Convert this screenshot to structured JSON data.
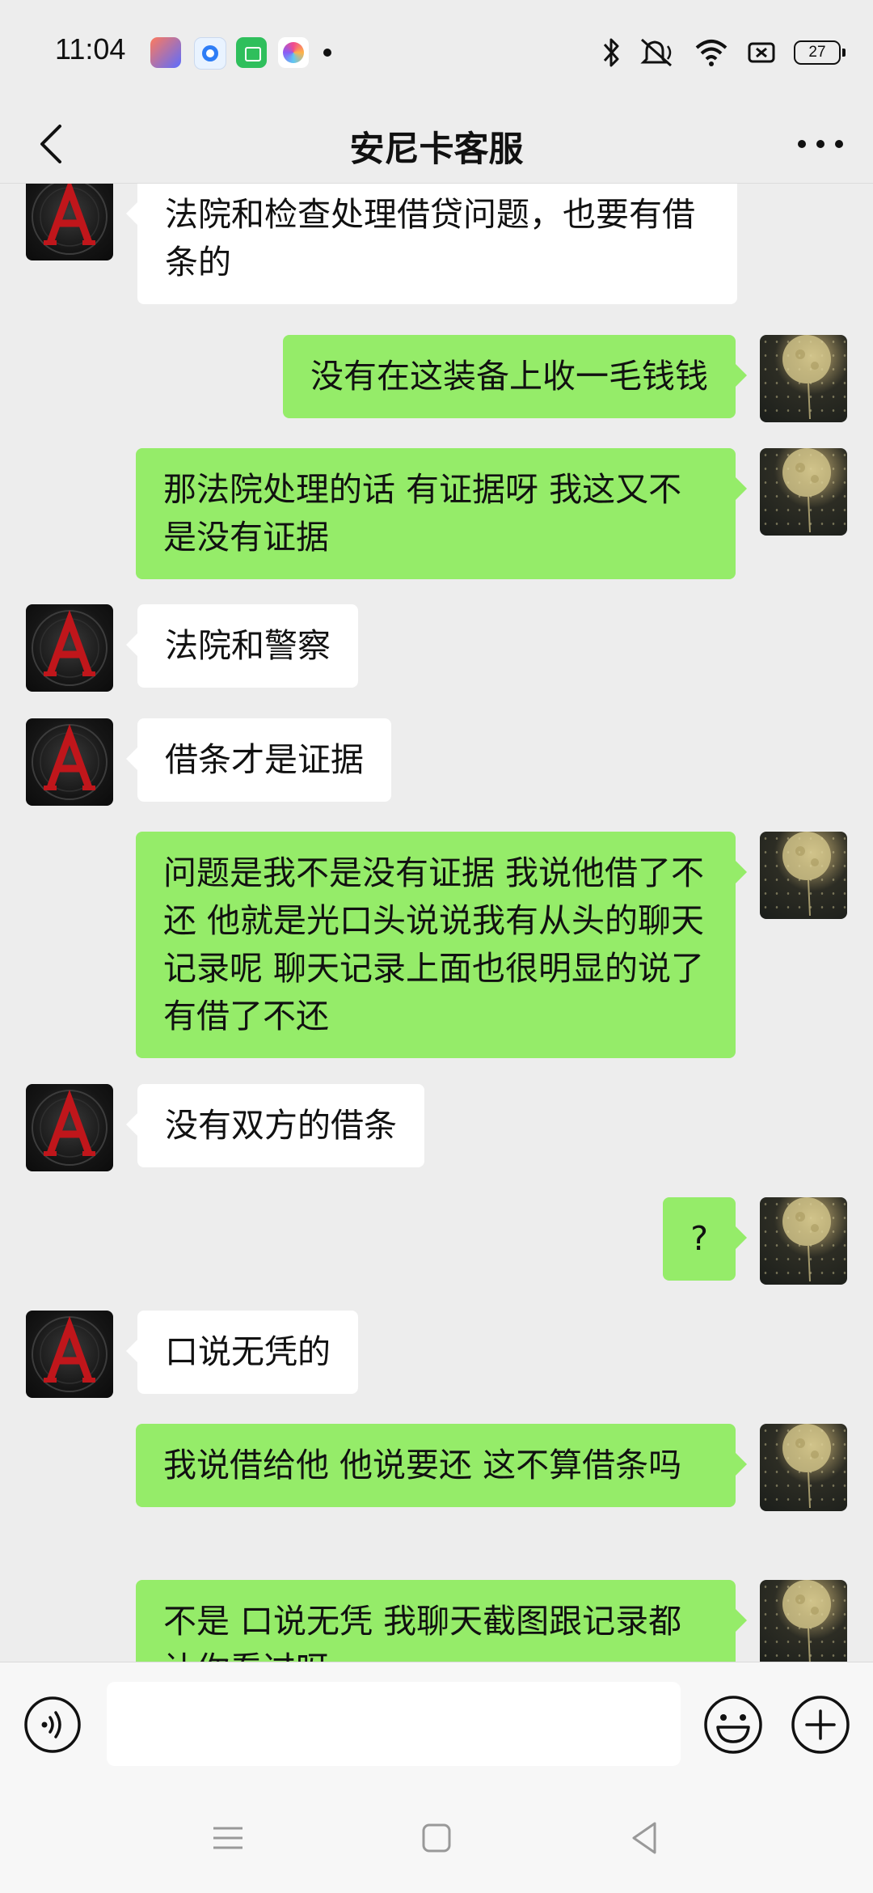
{
  "status_bar": {
    "time": "11:04",
    "battery": "27",
    "icons": [
      "app-notification-icon",
      "browser-icon",
      "shopping-icon",
      "gallery-icon",
      "bluetooth-icon",
      "mute-icon",
      "wifi-icon",
      "sim-icon",
      "battery-icon"
    ]
  },
  "header": {
    "title": "安尼卡客服"
  },
  "messages": [
    {
      "side": "left",
      "text": "法院和检查处理借贷问题，也要有借条的"
    },
    {
      "side": "right",
      "text": "没有在这装备上收一毛钱钱"
    },
    {
      "side": "right",
      "text": "那法院处理的话 有证据呀 我这又不是没有证据"
    },
    {
      "side": "left",
      "text": "法院和警察"
    },
    {
      "side": "left",
      "text": "借条才是证据"
    },
    {
      "side": "right",
      "text": "问题是我不是没有证据 我说他借了不还 他就是光口头说说我有从头的聊天记录呢 聊天记录上面也很明显的说了有借了不还"
    },
    {
      "side": "left",
      "text": "没有双方的借条"
    },
    {
      "side": "right",
      "text": "?"
    },
    {
      "side": "left",
      "text": "口说无凭的"
    },
    {
      "side": "right",
      "text": "我说借给他 他说要还 这不算借条吗"
    },
    {
      "side": "right",
      "text": "不是 口说无凭 我聊天截图跟记录都让你看过呀"
    }
  ],
  "input": {
    "placeholder": ""
  },
  "colors": {
    "background": "#ededed",
    "bubble_left": "#ffffff",
    "bubble_right": "#95ec69",
    "input_bar": "#f7f7f7"
  }
}
